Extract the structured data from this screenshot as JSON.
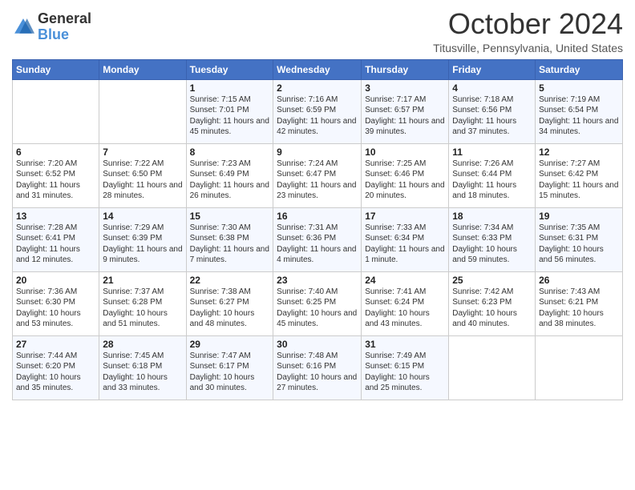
{
  "header": {
    "logo": {
      "general": "General",
      "blue": "Blue"
    },
    "title": "October 2024",
    "location": "Titusville, Pennsylvania, United States"
  },
  "days_of_week": [
    "Sunday",
    "Monday",
    "Tuesday",
    "Wednesday",
    "Thursday",
    "Friday",
    "Saturday"
  ],
  "weeks": [
    [
      null,
      null,
      {
        "day": "1",
        "sunrise": "Sunrise: 7:15 AM",
        "sunset": "Sunset: 7:01 PM",
        "daylight": "Daylight: 11 hours and 45 minutes."
      },
      {
        "day": "2",
        "sunrise": "Sunrise: 7:16 AM",
        "sunset": "Sunset: 6:59 PM",
        "daylight": "Daylight: 11 hours and 42 minutes."
      },
      {
        "day": "3",
        "sunrise": "Sunrise: 7:17 AM",
        "sunset": "Sunset: 6:57 PM",
        "daylight": "Daylight: 11 hours and 39 minutes."
      },
      {
        "day": "4",
        "sunrise": "Sunrise: 7:18 AM",
        "sunset": "Sunset: 6:56 PM",
        "daylight": "Daylight: 11 hours and 37 minutes."
      },
      {
        "day": "5",
        "sunrise": "Sunrise: 7:19 AM",
        "sunset": "Sunset: 6:54 PM",
        "daylight": "Daylight: 11 hours and 34 minutes."
      }
    ],
    [
      {
        "day": "6",
        "sunrise": "Sunrise: 7:20 AM",
        "sunset": "Sunset: 6:52 PM",
        "daylight": "Daylight: 11 hours and 31 minutes."
      },
      {
        "day": "7",
        "sunrise": "Sunrise: 7:22 AM",
        "sunset": "Sunset: 6:50 PM",
        "daylight": "Daylight: 11 hours and 28 minutes."
      },
      {
        "day": "8",
        "sunrise": "Sunrise: 7:23 AM",
        "sunset": "Sunset: 6:49 PM",
        "daylight": "Daylight: 11 hours and 26 minutes."
      },
      {
        "day": "9",
        "sunrise": "Sunrise: 7:24 AM",
        "sunset": "Sunset: 6:47 PM",
        "daylight": "Daylight: 11 hours and 23 minutes."
      },
      {
        "day": "10",
        "sunrise": "Sunrise: 7:25 AM",
        "sunset": "Sunset: 6:46 PM",
        "daylight": "Daylight: 11 hours and 20 minutes."
      },
      {
        "day": "11",
        "sunrise": "Sunrise: 7:26 AM",
        "sunset": "Sunset: 6:44 PM",
        "daylight": "Daylight: 11 hours and 18 minutes."
      },
      {
        "day": "12",
        "sunrise": "Sunrise: 7:27 AM",
        "sunset": "Sunset: 6:42 PM",
        "daylight": "Daylight: 11 hours and 15 minutes."
      }
    ],
    [
      {
        "day": "13",
        "sunrise": "Sunrise: 7:28 AM",
        "sunset": "Sunset: 6:41 PM",
        "daylight": "Daylight: 11 hours and 12 minutes."
      },
      {
        "day": "14",
        "sunrise": "Sunrise: 7:29 AM",
        "sunset": "Sunset: 6:39 PM",
        "daylight": "Daylight: 11 hours and 9 minutes."
      },
      {
        "day": "15",
        "sunrise": "Sunrise: 7:30 AM",
        "sunset": "Sunset: 6:38 PM",
        "daylight": "Daylight: 11 hours and 7 minutes."
      },
      {
        "day": "16",
        "sunrise": "Sunrise: 7:31 AM",
        "sunset": "Sunset: 6:36 PM",
        "daylight": "Daylight: 11 hours and 4 minutes."
      },
      {
        "day": "17",
        "sunrise": "Sunrise: 7:33 AM",
        "sunset": "Sunset: 6:34 PM",
        "daylight": "Daylight: 11 hours and 1 minute."
      },
      {
        "day": "18",
        "sunrise": "Sunrise: 7:34 AM",
        "sunset": "Sunset: 6:33 PM",
        "daylight": "Daylight: 10 hours and 59 minutes."
      },
      {
        "day": "19",
        "sunrise": "Sunrise: 7:35 AM",
        "sunset": "Sunset: 6:31 PM",
        "daylight": "Daylight: 10 hours and 56 minutes."
      }
    ],
    [
      {
        "day": "20",
        "sunrise": "Sunrise: 7:36 AM",
        "sunset": "Sunset: 6:30 PM",
        "daylight": "Daylight: 10 hours and 53 minutes."
      },
      {
        "day": "21",
        "sunrise": "Sunrise: 7:37 AM",
        "sunset": "Sunset: 6:28 PM",
        "daylight": "Daylight: 10 hours and 51 minutes."
      },
      {
        "day": "22",
        "sunrise": "Sunrise: 7:38 AM",
        "sunset": "Sunset: 6:27 PM",
        "daylight": "Daylight: 10 hours and 48 minutes."
      },
      {
        "day": "23",
        "sunrise": "Sunrise: 7:40 AM",
        "sunset": "Sunset: 6:25 PM",
        "daylight": "Daylight: 10 hours and 45 minutes."
      },
      {
        "day": "24",
        "sunrise": "Sunrise: 7:41 AM",
        "sunset": "Sunset: 6:24 PM",
        "daylight": "Daylight: 10 hours and 43 minutes."
      },
      {
        "day": "25",
        "sunrise": "Sunrise: 7:42 AM",
        "sunset": "Sunset: 6:23 PM",
        "daylight": "Daylight: 10 hours and 40 minutes."
      },
      {
        "day": "26",
        "sunrise": "Sunrise: 7:43 AM",
        "sunset": "Sunset: 6:21 PM",
        "daylight": "Daylight: 10 hours and 38 minutes."
      }
    ],
    [
      {
        "day": "27",
        "sunrise": "Sunrise: 7:44 AM",
        "sunset": "Sunset: 6:20 PM",
        "daylight": "Daylight: 10 hours and 35 minutes."
      },
      {
        "day": "28",
        "sunrise": "Sunrise: 7:45 AM",
        "sunset": "Sunset: 6:18 PM",
        "daylight": "Daylight: 10 hours and 33 minutes."
      },
      {
        "day": "29",
        "sunrise": "Sunrise: 7:47 AM",
        "sunset": "Sunset: 6:17 PM",
        "daylight": "Daylight: 10 hours and 30 minutes."
      },
      {
        "day": "30",
        "sunrise": "Sunrise: 7:48 AM",
        "sunset": "Sunset: 6:16 PM",
        "daylight": "Daylight: 10 hours and 27 minutes."
      },
      {
        "day": "31",
        "sunrise": "Sunrise: 7:49 AM",
        "sunset": "Sunset: 6:15 PM",
        "daylight": "Daylight: 10 hours and 25 minutes."
      },
      null,
      null
    ]
  ]
}
